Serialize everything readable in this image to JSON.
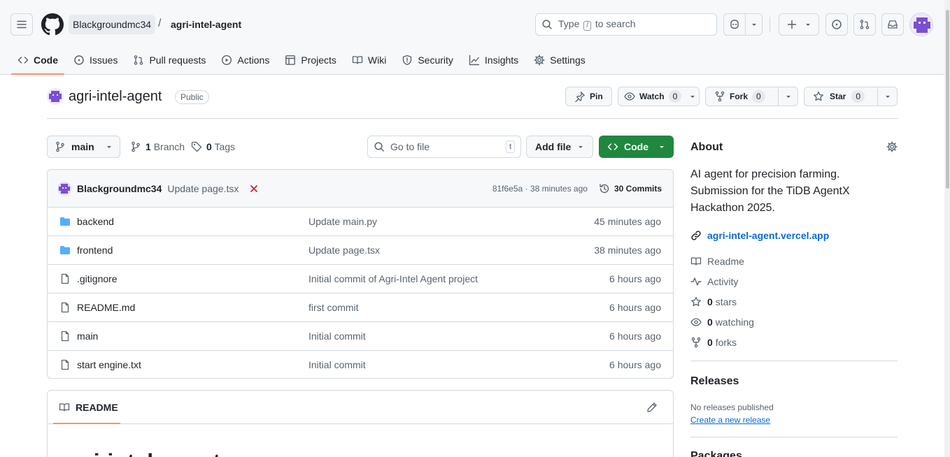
{
  "breadcrumb": {
    "owner": "Blackgroundmc34",
    "separator": "/",
    "repo": "agri-intel-agent"
  },
  "search": {
    "prefix": "Type",
    "key": "/",
    "suffix": "to search"
  },
  "tabs": [
    {
      "label": "Code",
      "icon": "code-icon"
    },
    {
      "label": "Issues",
      "icon": "issue-icon"
    },
    {
      "label": "Pull requests",
      "icon": "pull-request-icon"
    },
    {
      "label": "Actions",
      "icon": "play-icon"
    },
    {
      "label": "Projects",
      "icon": "table-icon"
    },
    {
      "label": "Wiki",
      "icon": "book-icon"
    },
    {
      "label": "Security",
      "icon": "shield-icon"
    },
    {
      "label": "Insights",
      "icon": "graph-icon"
    },
    {
      "label": "Settings",
      "icon": "gear-icon"
    }
  ],
  "repo": {
    "name": "agri-intel-agent",
    "visibility": "Public",
    "pin_label": "Pin",
    "watch_label": "Watch",
    "watch_count": "0",
    "fork_label": "Fork",
    "fork_count": "0",
    "star_label": "Star",
    "star_count": "0"
  },
  "filenav": {
    "branch": "main",
    "branches_count": "1",
    "branches_label": "Branch",
    "tags_count": "0",
    "tags_label": "Tags",
    "goto_placeholder": "Go to file",
    "goto_key": "t",
    "add_file_label": "Add file",
    "code_label": "Code"
  },
  "latest_commit": {
    "author": "Blackgroundmc34",
    "message": "Update page.tsx",
    "hash": "81f6e5a",
    "time": "38 minutes ago",
    "commits_count": "30",
    "commits_label": "Commits"
  },
  "files": [
    {
      "type": "folder",
      "name": "backend",
      "message": "Update main.py",
      "time": "45 minutes ago"
    },
    {
      "type": "folder",
      "name": "frontend",
      "message": "Update page.tsx",
      "time": "38 minutes ago"
    },
    {
      "type": "file",
      "name": ".gitignore",
      "message": "Initial commit of Agri-Intel Agent project",
      "time": "6 hours ago"
    },
    {
      "type": "file",
      "name": "README.md",
      "message": "first commit",
      "time": "6 hours ago"
    },
    {
      "type": "file",
      "name": "main",
      "message": "Initial commit",
      "time": "6 hours ago"
    },
    {
      "type": "file",
      "name": "start engine.txt",
      "message": "Initial commit",
      "time": "6 hours ago"
    }
  ],
  "readme": {
    "tab_label": "README",
    "heading": "agri-intel-agent"
  },
  "about": {
    "title": "About",
    "description": "AI agent for precision farming. Submission for the TiDB AgentX Hackathon 2025.",
    "link": "agri-intel-agent.vercel.app",
    "readme_label": "Readme",
    "activity_label": "Activity",
    "stars_count": "0",
    "stars_label": "stars",
    "watching_count": "0",
    "watching_label": "watching",
    "forks_count": "0",
    "forks_label": "forks"
  },
  "releases": {
    "title": "Releases",
    "none_text": "No releases published",
    "create_link": "Create a new release"
  },
  "packages": {
    "title": "Packages"
  },
  "colors": {
    "accent_green": "#1f883d",
    "tab_underline": "#fd8c73",
    "link_blue": "#0969da",
    "folder_blue": "#54aeff",
    "avatar_purple": "#7b4fd1"
  }
}
